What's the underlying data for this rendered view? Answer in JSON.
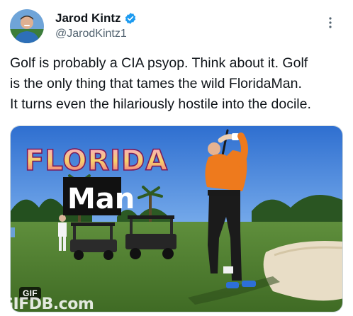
{
  "author": {
    "display_name": "Jarod Kintz",
    "handle": "@JarodKintz1",
    "verified": true
  },
  "tweet": {
    "text_lines": [
      "Golf is probably a CIA psyop. Think about it. Golf",
      "is the only thing that tames the wild FloridaMan.",
      "It turns even the hilariously hostile into the docile."
    ]
  },
  "media": {
    "type": "gif",
    "badge": "GIF",
    "title_line1": "FLORIDA",
    "title_line2": "Man",
    "watermark": "GIFDB.com"
  },
  "icons": {
    "verified": "verified-badge-icon",
    "more": "more-options-icon"
  },
  "colors": {
    "verified_blue": "#1d9bf0",
    "text_primary": "#0f1419",
    "text_secondary": "#536471"
  }
}
